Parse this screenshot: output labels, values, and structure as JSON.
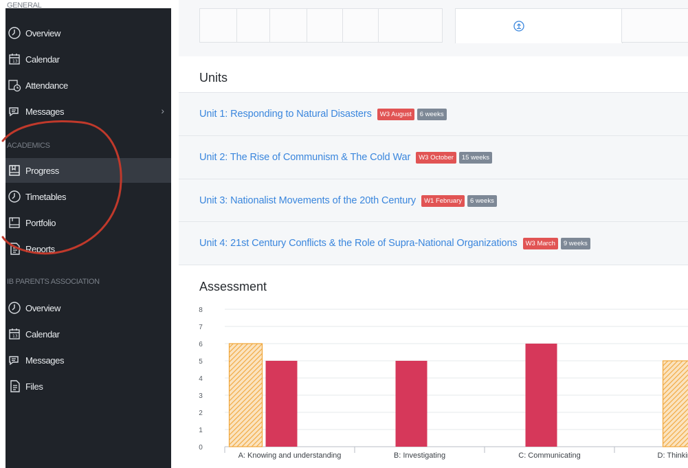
{
  "sidebar": {
    "sections": [
      {
        "heading": "GENERAL",
        "items": [
          {
            "label": "Overview",
            "icon": "clock-icon"
          },
          {
            "label": "Calendar",
            "icon": "calendar-icon"
          },
          {
            "label": "Attendance",
            "icon": "attendance-icon"
          },
          {
            "label": "Messages",
            "icon": "messages-icon",
            "chevron": "›"
          }
        ]
      },
      {
        "heading": "ACADEMICS",
        "items": [
          {
            "label": "Progress",
            "icon": "book-icon",
            "active": true
          },
          {
            "label": "Timetables",
            "icon": "clock-icon"
          },
          {
            "label": "Portfolio",
            "icon": "portfolio-icon"
          },
          {
            "label": "Reports",
            "icon": "reports-icon"
          }
        ]
      },
      {
        "heading": "IB PARENTS ASSOCIATION",
        "items": [
          {
            "label": "Overview",
            "icon": "clock-icon"
          },
          {
            "label": "Calendar",
            "icon": "calendar-icon"
          },
          {
            "label": "Messages",
            "icon": "messages-icon"
          },
          {
            "label": "Files",
            "icon": "files-icon"
          }
        ]
      }
    ]
  },
  "main": {
    "top_icon": "upload-icon",
    "units_title": "Units",
    "units": [
      {
        "title": "Unit 1: Responding to Natural Disasters",
        "start": "W3 August",
        "duration": "6 weeks"
      },
      {
        "title": "Unit 2: The Rise of Communism & The Cold War",
        "start": "W3 October",
        "duration": "15 weeks"
      },
      {
        "title": "Unit 3: Nationalist Movements of the 20th Century",
        "start": "W1 February",
        "duration": "6 weeks"
      },
      {
        "title": "Unit 4: 21st Century Conflicts & the Role of Supra-National Organizations",
        "start": "W3 March",
        "duration": "9 weeks"
      }
    ],
    "assessment_title": "Assessment"
  },
  "colors": {
    "sidebar_bg": "#1f2329",
    "link": "#3a86dd",
    "badge_red": "#e15454",
    "badge_gray": "#7d8896",
    "bar_solid": "#d6385a",
    "bar_hatched": "#f0a63a",
    "annotation": "#c0392b"
  },
  "chart_data": {
    "type": "bar",
    "title": "",
    "xlabel": "",
    "ylabel": "",
    "ylim": [
      0,
      8
    ],
    "yticks": [
      0,
      1,
      2,
      3,
      4,
      5,
      6,
      7,
      8
    ],
    "categories": [
      "A: Knowing and understanding",
      "B: Investigating",
      "C: Communicating",
      "D: Thinking c"
    ],
    "grid": true,
    "series": [
      {
        "style": "hatched",
        "values": [
          6,
          null,
          null,
          5
        ]
      },
      {
        "style": "solid",
        "values": [
          5,
          5,
          6,
          null
        ]
      }
    ]
  }
}
